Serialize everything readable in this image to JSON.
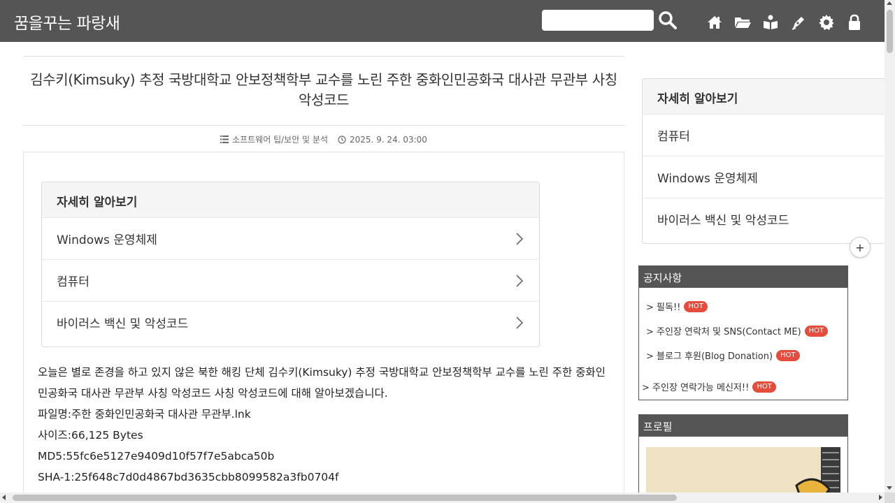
{
  "header": {
    "site_title": "꿈을꾸는 파랑새",
    "search_placeholder": "",
    "icons": [
      "search-icon",
      "home-icon",
      "folder-icon",
      "guestbook-icon",
      "write-icon",
      "settings-icon",
      "lock-icon"
    ]
  },
  "post": {
    "title": "김수키(Kimsuky) 추정 국방대학교 안보정책학부 교수를 노린 주한 중화인민공화국 대사관 무관부 사칭 악성코드",
    "category": "소프트웨어 팁/보안 및 분석",
    "date": "2025. 9. 24. 03:00",
    "learn_more": {
      "heading": "자세히 알아보기",
      "items": [
        "Windows 운영체제",
        "컴퓨터",
        "바이러스 백신 및 악성코드"
      ]
    },
    "paragraphs": [
      "오늘은 별로 존경을 하고 있지 않은 북한 해킹 단체 김수키(Kimsuky) 추정 국방대학교 안보정책학부 교수를 노린 주한 중화인민공화국 대사관 무관부 사칭 악성코드 사칭 악성코드에 대해 알아보겠습니다.",
      "파일명:주한 중화인민공화국 대사관 무관부.lnk",
      "사이즈:66,125 Bytes",
      "MD5:55fc6e5127e9409d10f57f7e5abca50b",
      "SHA-1:25f648c7d0d4867bd3635cbb8099582a3fb0704f"
    ]
  },
  "sidebar": {
    "learn_more": {
      "heading": "자세히 알아보기",
      "items": [
        "컴퓨터",
        "Windows 운영체제",
        "바이러스 백신 및 악성코드"
      ]
    },
    "plus_label": "+",
    "notice": {
      "heading": "공지사항",
      "items": [
        {
          "label": "> 필독!!",
          "badge": "HOT"
        },
        {
          "label": "> 주인장 연락처 및 SNS(Contact ME)",
          "badge": "HOT"
        },
        {
          "label": "> 블로그 후원(Blog Donation)",
          "badge": "HOT"
        },
        {
          "label": "> 주인장 연락가능 메신저!!",
          "badge": "HOT"
        }
      ]
    },
    "profile": {
      "heading": "프로필"
    }
  },
  "colors": {
    "header_bg": "#555555",
    "hot_badge": "#e64c3c",
    "card_head_bg": "#f5f5f5"
  }
}
